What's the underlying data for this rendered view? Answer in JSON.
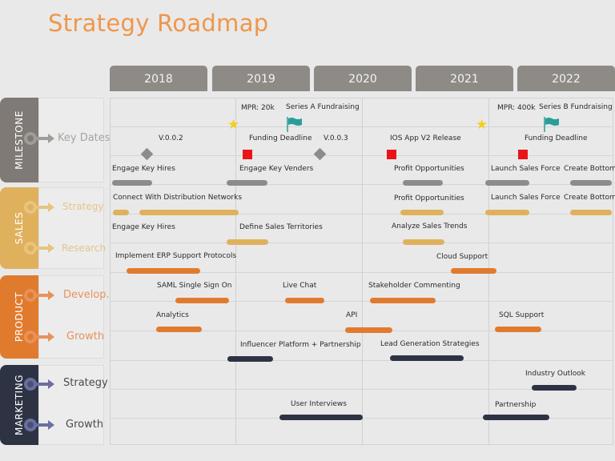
{
  "title": "Strategy Roadmap",
  "years": [
    "2018",
    "2019",
    "2020",
    "2021",
    "2022"
  ],
  "colors": {
    "title": "#f0964a",
    "year_header": "#8e8a85",
    "milestone": "#7f7a75",
    "sales": "#e0b15c",
    "product": "#e07b2e",
    "marketing": "#2e3344",
    "milestone_bar": "#8c8c8c",
    "red_marker": "#e8141a",
    "star": "#f2cf1c",
    "flag": "#2a9d9a"
  },
  "sections": [
    {
      "name": "MILESTONE",
      "rows": [
        "Key Dates"
      ]
    },
    {
      "name": "SALES",
      "rows": [
        "Strategy",
        "Research"
      ]
    },
    {
      "name": "PRODUCT",
      "rows": [
        "Develop.",
        "Growth"
      ]
    },
    {
      "name": "MARKETING",
      "rows": [
        "Strategy",
        "Growth"
      ]
    }
  ],
  "milestones": {
    "mpr_1": "MPR: 20k",
    "series_a": "Series A  Fundraising",
    "mpr_2": "MPR: 400k",
    "series_b": "Series B  Fundraising",
    "v002": "V.0.0.2",
    "funding_deadline_1": "Funding Deadline",
    "v003": "V.0.0.3",
    "ios_release": "IOS App V2 Release",
    "funding_deadline_2": "Funding Deadline",
    "engage_key_hires": "Engage Key Hires",
    "engage_key_venders": "Engage Key Venders",
    "profit_opportunities": "Profit Opportunities",
    "launch_sales_force": "Launch Sales Force",
    "create_bottom": "Create Bottom"
  },
  "sales": {
    "connect_networks": "Connect With Distribution Networks",
    "profit_opportunities": "Profit Opportunities",
    "launch_sales_force": "Launch Sales Force",
    "create_bottom": "Create Bottom",
    "engage_key_hires": "Engage Key Hires",
    "define_territories": "Define Sales Territories",
    "analyze_trends": "Analyze Sales Trends"
  },
  "product": {
    "erp_protocols": "Implement ERP Support Protocols",
    "cloud_support": "Cloud Support",
    "saml_sso": "SAML Single Sign On",
    "live_chat": "Live Chat",
    "stakeholder_commenting": "Stakeholder Commenting",
    "analytics": "Analytics",
    "api": "API",
    "sql_support": "SQL Support"
  },
  "marketing": {
    "influencer_platform": "Influencer Platform + Partnership",
    "lead_generation": "Lead Generation Strategies",
    "industry_outlook": "Industry Outlook",
    "user_interviews": "User Interviews",
    "partnership": "Partnership"
  }
}
